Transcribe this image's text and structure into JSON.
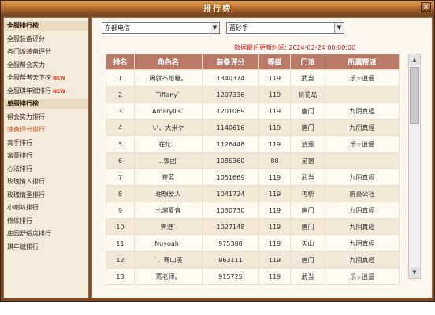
{
  "window": {
    "title": "排行榜",
    "close": "×"
  },
  "sidebar": {
    "items": [
      {
        "label": "全服排行榜",
        "type": "header"
      },
      {
        "label": "全服装备评分",
        "type": "item"
      },
      {
        "label": "各门派装备评分",
        "type": "item"
      },
      {
        "label": "全服帮会实力",
        "type": "item"
      },
      {
        "label": "全服帮者天下榜",
        "type": "item",
        "badge": "NEW"
      },
      {
        "label": "全服琪年赋排行",
        "type": "item",
        "badge": "NEW"
      },
      {
        "label": "单服排行榜",
        "type": "header"
      },
      {
        "label": "帮会实力排行",
        "type": "item"
      },
      {
        "label": "装备评分排行",
        "type": "active"
      },
      {
        "label": "高手排行",
        "type": "item"
      },
      {
        "label": "富豪排行",
        "type": "item"
      },
      {
        "label": "心法排行",
        "type": "item"
      },
      {
        "label": "玫瑰情人排行",
        "type": "item"
      },
      {
        "label": "玫瑰情圣排行",
        "type": "item"
      },
      {
        "label": "小喇叭排行",
        "type": "item"
      },
      {
        "label": "修炼排行",
        "type": "item"
      },
      {
        "label": "庄园舒适度排行",
        "type": "item"
      },
      {
        "label": "琪年赋排行",
        "type": "item"
      }
    ]
  },
  "filters": {
    "region": "东部电信",
    "server": "蓝砂手"
  },
  "update": {
    "label": "数据最后更新时间:",
    "time": "2024-02-24 00:00:00"
  },
  "table": {
    "headers": [
      "排名",
      "角色名",
      "装备评分",
      "等级",
      "门派",
      "所属帮派"
    ],
    "rows": [
      [
        "1",
        "闲就不给糖。",
        "1340374",
        "119",
        "武当",
        "乐☆逍遥"
      ],
      [
        "2",
        "Tiffany`",
        "1207336",
        "119",
        "桃花岛",
        ""
      ],
      [
        "3",
        "Amaryllis`",
        "1201069",
        "119",
        "唐门",
        "九阴真經"
      ],
      [
        "4",
        "い、大米ヤ",
        "1140616",
        "119",
        "唐门",
        "九阴真經"
      ],
      [
        "5",
        "在忙、",
        "1126448",
        "119",
        "逍遥",
        "乐☆逍遥"
      ],
      [
        "6",
        "…饭团`",
        "1086360",
        "88",
        "星宿",
        ""
      ],
      [
        "7",
        "苍蓝",
        "1051669",
        "119",
        "武当",
        "九阴真經"
      ],
      [
        "8",
        "理想爱人",
        "1041724",
        "119",
        "丐帮",
        "腕豪公社"
      ],
      [
        "9",
        "七濑夏音",
        "1030730",
        "119",
        "唐门",
        "九阴真經"
      ],
      [
        "10",
        "霁澄`",
        "1027148",
        "119",
        "唐门",
        "九阴真經"
      ],
      [
        "11",
        "Nuyoah`",
        "975388",
        "119",
        "天山",
        "九阴真經"
      ],
      [
        "12",
        "`、骞山溪",
        "963111",
        "119",
        "唐门",
        "九阴真經"
      ],
      [
        "13",
        "蔫老师。",
        "915725",
        "119",
        "武当",
        "乐☆逍遥"
      ]
    ]
  },
  "colors": {
    "accent": "#b97a68",
    "frame": "#7a4a28",
    "highlight": "#d02020"
  }
}
